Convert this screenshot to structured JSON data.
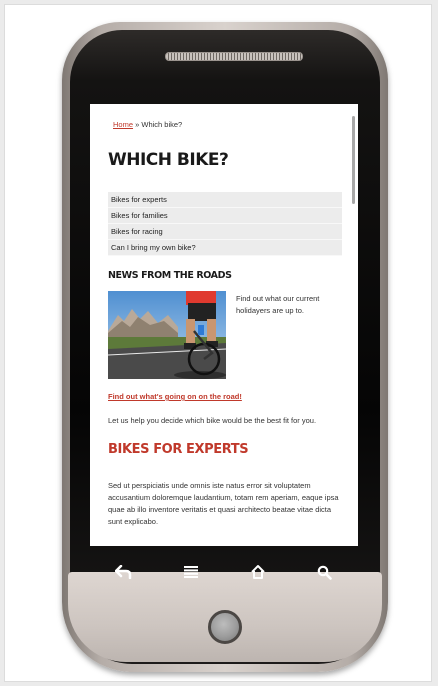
{
  "breadcrumb": {
    "home": "Home",
    "separator": "»",
    "current": "Which bike?"
  },
  "page_title": "WHICH BIKE?",
  "menu_items": [
    {
      "label": "Bikes for experts"
    },
    {
      "label": "Bikes for families"
    },
    {
      "label": "Bikes for racing"
    },
    {
      "label": "Can I bring my own bike?"
    }
  ],
  "news": {
    "title": "NEWS FROM THE ROADS",
    "text": "Find out what our current holidayers are up to.",
    "link": "Find out what's going on on the road!"
  },
  "intro": "Let us help you decide which bike would be the best fit for you.",
  "section": {
    "title": "BIKES FOR EXPERTS",
    "body": "Sed ut perspiciatis unde omnis iste natus error sit voluptatem accusantium doloremque laudantium, totam rem aperiam, eaque ipsa quae ab illo inventore veritatis et quasi architecto beatae vitae dicta sunt explicabo."
  },
  "nav_icons": [
    "back-icon",
    "menu-icon",
    "home-icon",
    "search-icon"
  ],
  "colors": {
    "accent": "#c0392b",
    "menu_bg": "#ececec",
    "text": "#333333",
    "heading": "#1a1a1a"
  }
}
